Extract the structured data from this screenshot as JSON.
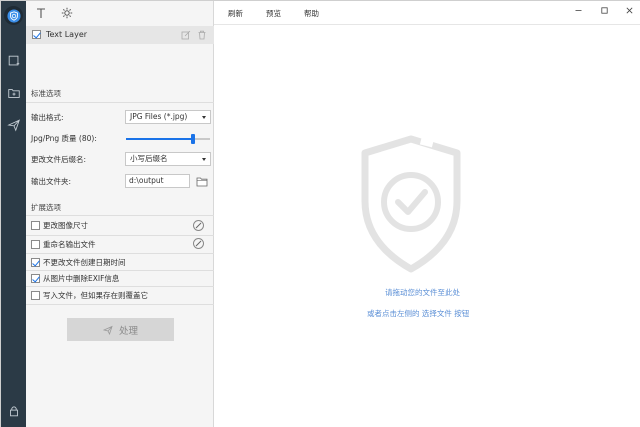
{
  "panel": {
    "layer": {
      "label": "Text Layer",
      "checked": true
    },
    "standard": {
      "title": "标准选项",
      "output_format_label": "输出格式:",
      "output_format_value": "JPG Files (*.jpg)",
      "quality_label": "Jpg/Png 质量 (80):",
      "quality_value": 80,
      "ext_label": "更改文件后缀名:",
      "ext_value": "小写后缀名",
      "output_folder_label": "输出文件夹:",
      "output_folder_value": "d:\\output"
    },
    "extended": {
      "title": "扩展选项",
      "options": [
        {
          "label": "更改图像尺寸",
          "checked": false
        },
        {
          "label": "重命名输出文件",
          "checked": false
        },
        {
          "label": "不更改文件创建日期时间",
          "checked": true
        },
        {
          "label": "从图片中删除EXIF信息",
          "checked": true
        },
        {
          "label": "写入文件，但如果存在则覆盖它",
          "checked": false
        }
      ]
    },
    "process_label": "处理"
  },
  "menu": {
    "refresh": "刷新",
    "preview": "预览",
    "help": "帮助"
  },
  "drop": {
    "line1": "请拖动您的文件至此处",
    "line2": "或者点击左侧的 选择文件 按钮"
  },
  "colors": {
    "rail": "#2b3a46",
    "accent": "#1a73e8",
    "hint": "#5b8fd6",
    "illustration": "#e3e3e3"
  }
}
